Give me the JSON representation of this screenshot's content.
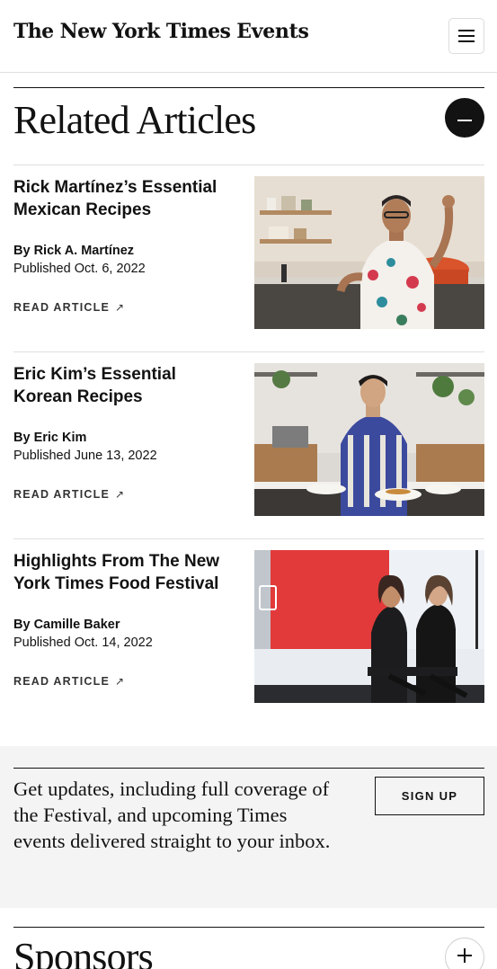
{
  "header": {
    "logo_primary": "The New York Times",
    "logo_secondary": "Events",
    "menu_icon": "hamburger-menu-icon"
  },
  "related": {
    "title": "Related Articles",
    "toggle_icon": "minus-icon",
    "articles": [
      {
        "title": "Rick Martínez’s Essential Mexican Recipes",
        "by_prefix": "By ",
        "author": "Rick A. Martínez",
        "published": "Published Oct. 6, 2022",
        "link_label": "READ ARTICLE",
        "link_icon": "arrow-up-right-icon",
        "image": "chef-in-kitchen-photo"
      },
      {
        "title": "Eric Kim’s Essential Korean Recipes",
        "by_prefix": "By ",
        "author": "Eric Kim",
        "published": "Published June 13, 2022",
        "link_label": "READ ARTICLE",
        "link_icon": "arrow-up-right-icon",
        "image": "cook-plating-food-photo"
      },
      {
        "title": "Highlights From The New York Times Food Festival",
        "by_prefix": "By ",
        "author": "Camille Baker",
        "published": "Published Oct. 14, 2022",
        "link_label": "READ ARTICLE",
        "link_icon": "arrow-up-right-icon",
        "image": "festival-stage-photo"
      }
    ]
  },
  "newsletter": {
    "text": "Get updates, including full coverage of the Festival, and upcoming Times events delivered straight to your inbox.",
    "button_label": "SIGN UP"
  },
  "sponsors": {
    "title": "Sponsors",
    "toggle_icon": "plus-icon"
  }
}
